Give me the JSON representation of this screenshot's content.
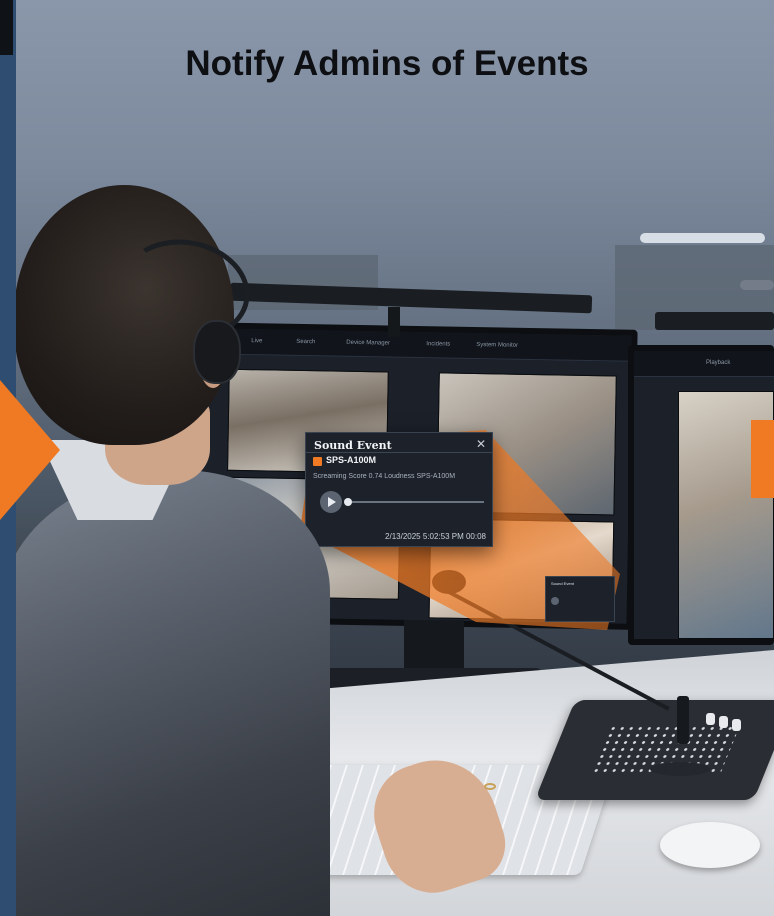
{
  "headline": "Notify Admins of Events",
  "vms": {
    "menu": [
      "Live",
      "Playback",
      "Search",
      "Device Manager",
      "Incidents",
      "System Monitor"
    ]
  },
  "sound_event_popup": {
    "title": "Sound Event",
    "close_icon": "close-icon",
    "device_name": "SPS-A100M",
    "description": "Screaming Score 0.74 Loudness SPS-A100M",
    "timestamp": "2/13/2025  5:02:53  PM  00:08",
    "controls": {
      "play_icon": "play-icon"
    }
  },
  "colors": {
    "accent": "#f07a24",
    "popup_bg": "#1d222a",
    "headline": "#0d0f12"
  }
}
